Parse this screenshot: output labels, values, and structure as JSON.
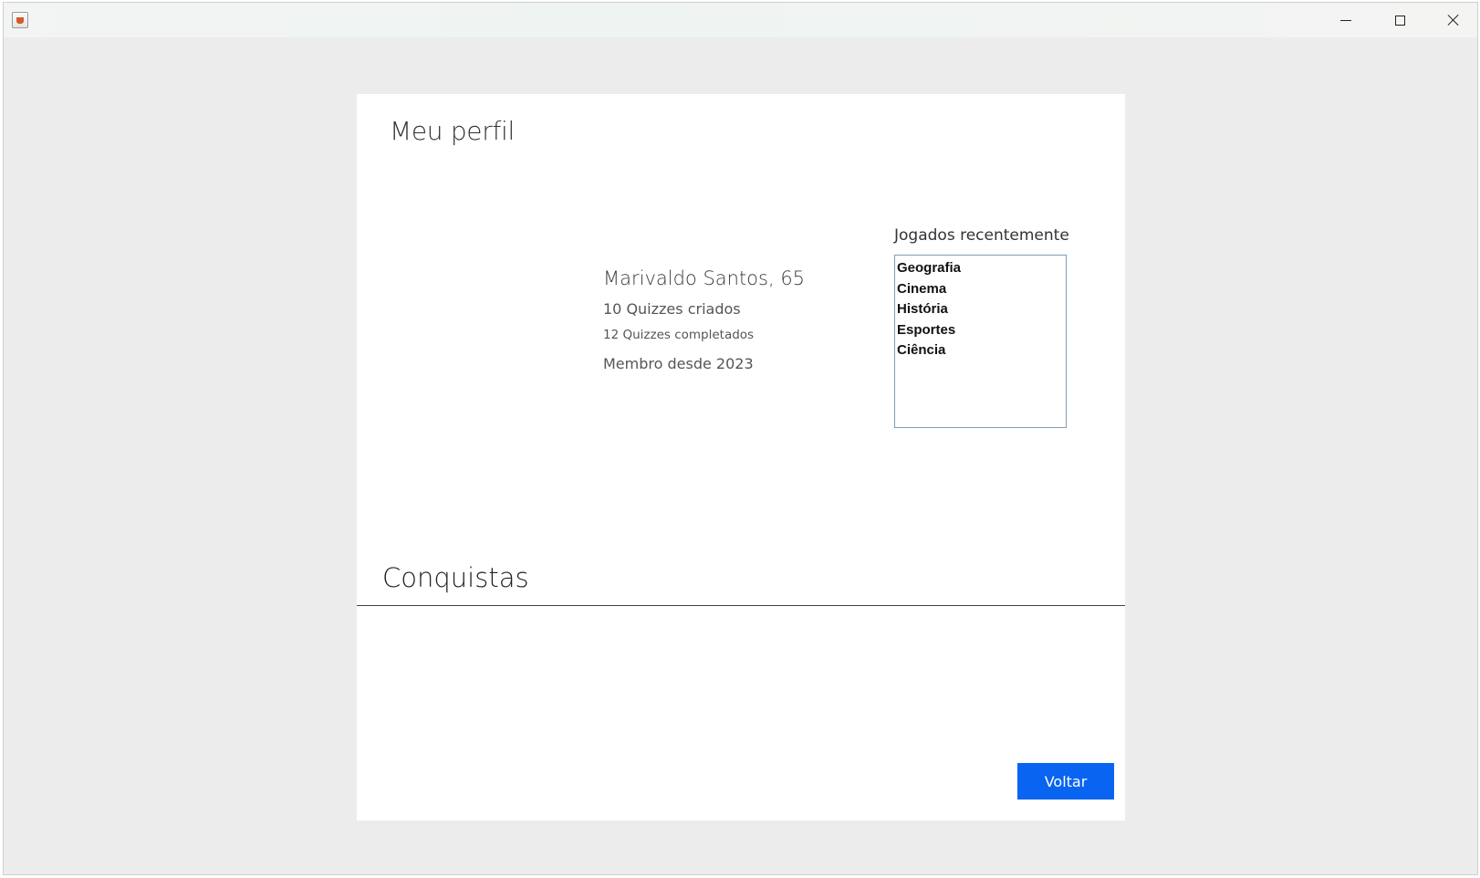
{
  "window": {
    "controls": {
      "minimize_icon": "minimize-icon",
      "maximize_icon": "maximize-icon",
      "close_icon": "close-icon"
    }
  },
  "profile": {
    "title": "Meu perfil",
    "user_name": "Marivaldo Santos, 65",
    "quizzes_created": "10 Quizzes criados",
    "quizzes_completed": "12 Quizzes completados",
    "member_since": "Membro desde 2023"
  },
  "recent": {
    "label": "Jogados recentemente",
    "items": [
      "Geografia",
      "Cinema",
      "História",
      "Esportes",
      "Ciência"
    ]
  },
  "achievements": {
    "title": "Conquistas"
  },
  "actions": {
    "back_label": "Voltar"
  },
  "colors": {
    "accent": "#0a64f2",
    "window_bg": "#ececec",
    "panel_bg": "#ffffff"
  }
}
